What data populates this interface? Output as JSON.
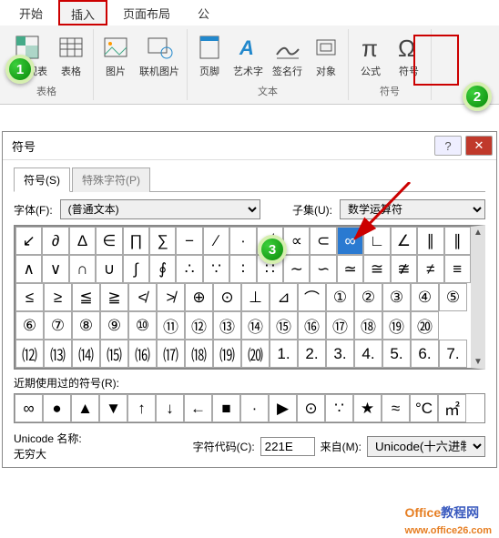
{
  "ribbon": {
    "tabs": [
      "开始",
      "插入",
      "页面布局",
      "公"
    ],
    "active_tab": 1,
    "groups": {
      "tables": {
        "pivot": "据透视表",
        "table": "表格",
        "label": "表格"
      },
      "illus": {
        "picture": "图片",
        "online_pic": "联机图片"
      },
      "text": {
        "header_footer": "页脚",
        "wordart": "艺术字",
        "sigline": "签名行",
        "object": "对象",
        "label": "文本"
      },
      "symbols": {
        "equation": "公式",
        "symbol": "符号",
        "label": "符号"
      }
    }
  },
  "badges": {
    "one": "1",
    "two": "2",
    "three": "3"
  },
  "dialog": {
    "title": "符号",
    "tabs": {
      "symbols": "符号(S)",
      "special": "特殊字符(P)"
    },
    "font_label": "字体(F):",
    "font_value": "(普通文本)",
    "subset_label": "子集(U):",
    "subset_value": "数学运算符",
    "grid": [
      [
        "↙",
        "∂",
        "Δ",
        "∈",
        "∏",
        "∑",
        "−",
        "∕",
        "∙",
        "√",
        "∝",
        "⊂",
        "∞",
        "∟",
        "∠",
        "∥",
        "∥"
      ],
      [
        "∧",
        "∨",
        "∩",
        "∪",
        "∫",
        "∮",
        "∴",
        "∵",
        "∶",
        "∷",
        "∼",
        "∽",
        "≃",
        "≅",
        "≇",
        "≠",
        "≡"
      ],
      [
        "≤",
        "≥",
        "≦",
        "≧",
        "≮",
        "≯",
        "⊕",
        "⊙",
        "⊥",
        "⊿",
        "⌒",
        "①",
        "②",
        "③",
        "④",
        "⑤"
      ],
      [
        "⑥",
        "⑦",
        "⑧",
        "⑨",
        "⑩",
        "⑪",
        "⑫",
        "⑬",
        "⑭",
        "⑮",
        "⑯",
        "⑰",
        "⑱",
        "⑲",
        "⑳"
      ],
      [
        "⑿",
        "⒀",
        "⒁",
        "⒂",
        "⒃",
        "⒄",
        "⒅",
        "⒆",
        "⒇",
        "1.",
        "2.",
        "3.",
        "4.",
        "5.",
        "6.",
        "7."
      ]
    ],
    "selected_row": 0,
    "selected_col": 12,
    "recent_label": "近期使用过的符号(R):",
    "recent": [
      "∞",
      "●",
      "▲",
      "▼",
      "↑",
      "↓",
      "←",
      "■",
      "∙",
      "▶",
      "⊙",
      "∵",
      "★",
      "≈",
      "°C",
      "㎡"
    ],
    "unicode_name_label": "Unicode 名称:",
    "unicode_name": "无穷大",
    "code_label": "字符代码(C):",
    "code_value": "221E",
    "from_label": "来自(M):",
    "from_value": "Unicode(十六进制)"
  },
  "watermark": {
    "brand": "Office",
    "suffix": "教程网",
    "url": "www.office26.com"
  }
}
